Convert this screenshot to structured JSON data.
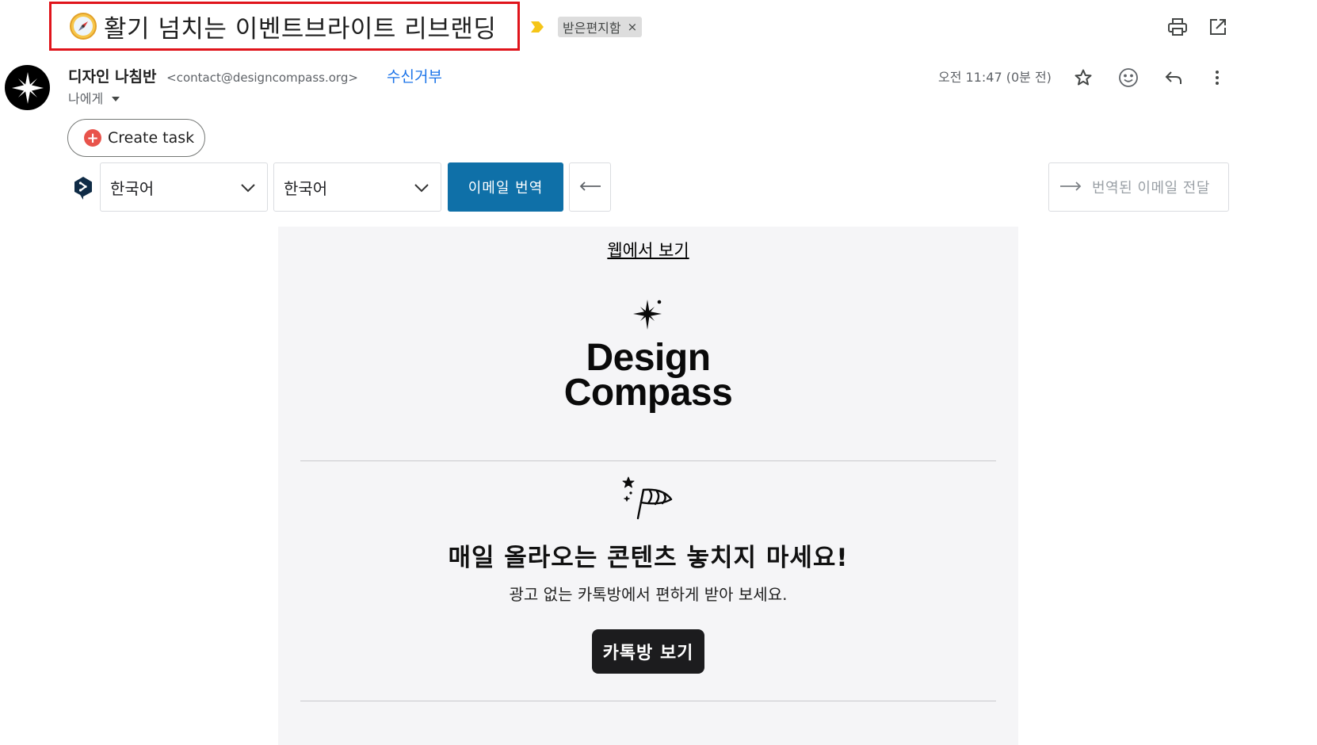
{
  "subject": {
    "text": "활기 넘치는 이벤트브라이트 리브랜딩",
    "emoji_icon": "compass-icon"
  },
  "label_chip": {
    "label": "받은편지함",
    "remove": "×"
  },
  "toolbar": {
    "print_icon": "print-icon",
    "open_new_window_icon": "open-in-new-icon"
  },
  "sender": {
    "name": "디자인 나침반",
    "email": "<contact@designcompass.org>",
    "unsubscribe": "수신거부",
    "recipient": "나에게",
    "timestamp": "오전 11:47 (0분 전)"
  },
  "actions": {
    "star_icon": "star-icon",
    "emoji_icon": "emoji-react-icon",
    "reply_icon": "reply-icon",
    "more_icon": "more-vert-icon"
  },
  "create_task": {
    "label": "Create task"
  },
  "translation": {
    "source_lang": "한국어",
    "target_lang": "한국어",
    "translate_button": "이메일 번역",
    "forward_button": "번역된 이메일 전달"
  },
  "email": {
    "view_on_web": "웹에서 보기",
    "brand_line1": "Design",
    "brand_line2": "Compass",
    "promo_heading": "매일 올라오는 콘텐츠 놓치지 마세요!",
    "promo_sub": "광고 없는 카톡방에서 편하게 받아 보세요.",
    "cta_button": "카톡방 보기"
  },
  "colors": {
    "highlight_border": "#e0141b",
    "link_blue": "#1a73e8",
    "translate_button": "#0f70a8",
    "cta_background": "#1c1c1e",
    "email_background": "#f5f5f7",
    "importance_marker": "#f5c518"
  }
}
